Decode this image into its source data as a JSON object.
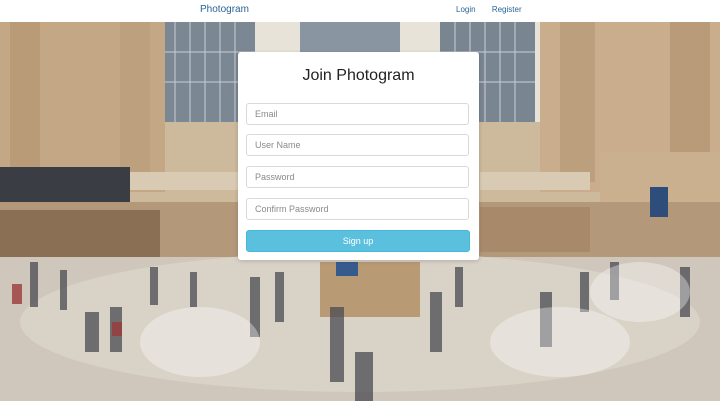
{
  "navbar": {
    "brand": "Photogram",
    "login": "Login",
    "register": "Register"
  },
  "signup": {
    "title": "Join Photogram",
    "email_placeholder": "Email",
    "username_placeholder": "User Name",
    "password_placeholder": "Password",
    "confirm_placeholder": "Confirm Password",
    "submit_label": "Sign up"
  },
  "colors": {
    "brand_link": "#2a6496",
    "button": "#5bc0de",
    "card_bg": "#ffffff"
  }
}
